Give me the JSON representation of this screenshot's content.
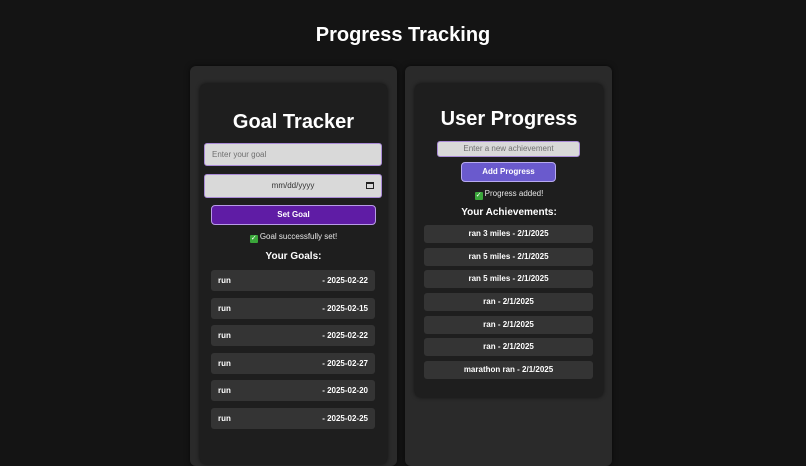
{
  "page": {
    "title": "Progress Tracking"
  },
  "goal_tracker": {
    "title": "Goal Tracker",
    "goal_placeholder": "Enter your goal",
    "date_placeholder": "mm/dd/yyyy",
    "set_goal_label": "Set Goal",
    "status": "Goal successfully set!",
    "list_heading": "Your Goals:",
    "goals": [
      {
        "name": "run",
        "date": "- 2025-02-22"
      },
      {
        "name": "run",
        "date": "- 2025-02-15"
      },
      {
        "name": "run",
        "date": "- 2025-02-22"
      },
      {
        "name": "run",
        "date": "- 2025-02-27"
      },
      {
        "name": "run",
        "date": "- 2025-02-20"
      },
      {
        "name": "run",
        "date": "- 2025-02-25"
      }
    ]
  },
  "user_progress": {
    "title": "User Progress",
    "achievement_placeholder": "Enter a new achievement",
    "add_progress_label": "Add Progress",
    "status": "Progress added!",
    "list_heading": "Your Achievements:",
    "achievements": [
      "ran 3 miles - 2/1/2025",
      "ran 5 miles - 2/1/2025",
      "ran 5 miles - 2/1/2025",
      "ran - 2/1/2025",
      "ran - 2/1/2025",
      "ran - 2/1/2025",
      "marathon ran - 2/1/2025"
    ]
  },
  "icons": {
    "status_check": "check-mark-icon",
    "calendar": "calendar-icon"
  },
  "colors": {
    "background": "#141414",
    "set_goal_button": "#5f1ca5",
    "add_progress_button": "#6a5acd",
    "check_badge": "#3aa63a"
  }
}
